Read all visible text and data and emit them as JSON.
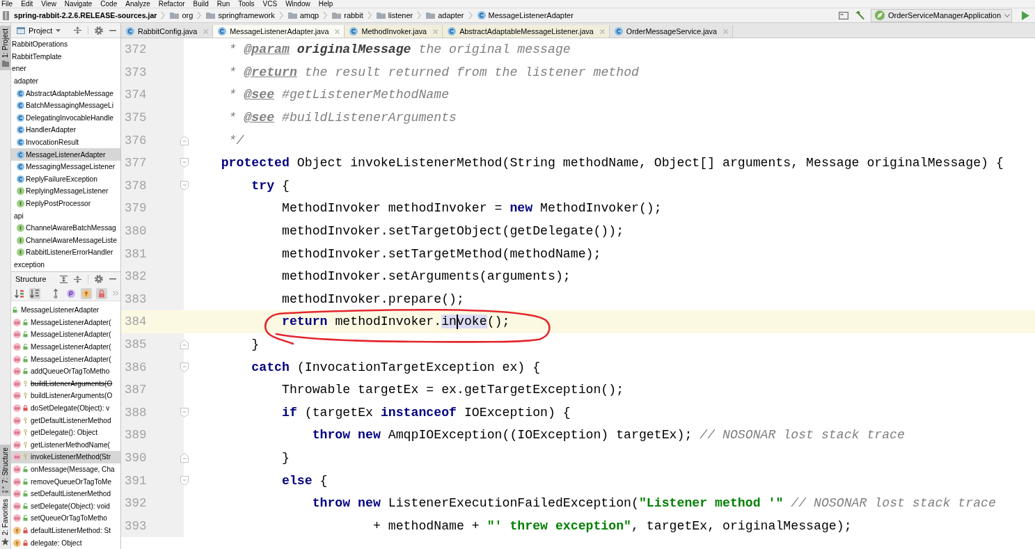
{
  "menu_bar": {
    "items": [
      "File",
      "Edit",
      "View",
      "Navigate",
      "Code",
      "Analyze",
      "Refactor",
      "Build",
      "Run",
      "Tools",
      "VCS",
      "Window",
      "Help"
    ]
  },
  "navigation_bar": {
    "breadcrumbs": [
      {
        "label": "spring-rabbit-2.2.6.RELEASE-sources.jar",
        "kind": "jar"
      },
      {
        "label": "org",
        "kind": "package"
      },
      {
        "label": "springframework",
        "kind": "package"
      },
      {
        "label": "amqp",
        "kind": "package"
      },
      {
        "label": "rabbit",
        "kind": "package"
      },
      {
        "label": "listener",
        "kind": "package"
      },
      {
        "label": "adapter",
        "kind": "package"
      },
      {
        "label": "MessageListenerAdapter",
        "kind": "class"
      }
    ],
    "run_configuration": "OrderServiceManagerApplication"
  },
  "tool_window_bar": [
    {
      "label": "1: Project",
      "kind": "project",
      "selected": true
    },
    {
      "label": "7: Structure",
      "kind": "structure",
      "selected": true
    },
    {
      "label": "2: Favorites",
      "kind": "favorites",
      "selected": false
    }
  ],
  "project_panel": {
    "title": "Project",
    "tree": [
      {
        "label": "RabbitOperations",
        "selected": false
      },
      {
        "label": "RabbitTemplate",
        "selected": false
      },
      {
        "label": "ener",
        "selected": false,
        "children": [
          {
            "label": "adapter",
            "selected": false,
            "children": [
              {
                "label": "AbstractAdaptableMessage",
                "kind": "class",
                "selected": false
              },
              {
                "label": "BatchMessagingMessageLi",
                "kind": "class",
                "selected": false
              },
              {
                "label": "DelegatingInvocableHandle",
                "kind": "class",
                "selected": false
              },
              {
                "label": "HandlerAdapter",
                "kind": "class",
                "selected": false
              },
              {
                "label": "InvocationResult",
                "kind": "class",
                "selected": false
              },
              {
                "label": "MessageListenerAdapter",
                "kind": "class",
                "selected": true
              },
              {
                "label": "MessagingMessageListener",
                "kind": "class",
                "selected": false
              },
              {
                "label": "ReplyFailureException",
                "kind": "class",
                "selected": false
              },
              {
                "label": "ReplyingMessageListener",
                "kind": "interface",
                "selected": false
              },
              {
                "label": "ReplyPostProcessor",
                "kind": "interface",
                "selected": false
              }
            ]
          },
          {
            "label": "api",
            "selected": false,
            "children": [
              {
                "label": "ChannelAwareBatchMessag",
                "kind": "interface",
                "selected": false
              },
              {
                "label": "ChannelAwareMessageListe",
                "kind": "interface",
                "selected": false
              },
              {
                "label": "RabbitListenerErrorHandler",
                "kind": "interface",
                "selected": false
              }
            ]
          },
          {
            "label": "exception",
            "selected": false
          }
        ]
      }
    ]
  },
  "structure_panel": {
    "title": "Structure",
    "toolbar": [
      {
        "kind": "sort-visibility",
        "on": false
      },
      {
        "kind": "sort-alpha",
        "on": true
      },
      {
        "kind": "inherited",
        "on": false
      },
      {
        "kind": "properties",
        "on": false
      },
      {
        "kind": "fields",
        "on": true
      },
      {
        "kind": "non-public",
        "on": true
      }
    ],
    "root": {
      "label": "MessageListenerAdapter",
      "kind": "public-class"
    },
    "members": [
      {
        "label": "MessageListenerAdapter(",
        "kind": "public-method",
        "deprecated": false,
        "selected": false
      },
      {
        "label": "MessageListenerAdapter(",
        "kind": "public-method",
        "deprecated": false,
        "selected": false
      },
      {
        "label": "MessageListenerAdapter(",
        "kind": "public-method",
        "deprecated": false,
        "selected": false
      },
      {
        "label": "MessageListenerAdapter(",
        "kind": "public-method",
        "deprecated": false,
        "selected": false
      },
      {
        "label": "addQueueOrTagToMetho",
        "kind": "public-method",
        "deprecated": false,
        "selected": false
      },
      {
        "label": "buildListenerArguments(O",
        "kind": "protected-method",
        "deprecated": true,
        "selected": false
      },
      {
        "label": "buildListenerArguments(O",
        "kind": "protected-method",
        "deprecated": false,
        "selected": false
      },
      {
        "label": "doSetDelegate(Object): v",
        "kind": "private-method",
        "deprecated": false,
        "selected": false
      },
      {
        "label": "getDefaultListenerMethod",
        "kind": "protected-method",
        "deprecated": false,
        "selected": false
      },
      {
        "label": "getDelegate(): Object",
        "kind": "protected-method",
        "deprecated": false,
        "selected": false
      },
      {
        "label": "getListenerMethodName(",
        "kind": "protected-method",
        "deprecated": false,
        "selected": false
      },
      {
        "label": "invokeListenerMethod(Str",
        "kind": "protected-method",
        "deprecated": false,
        "selected": true
      },
      {
        "label": "onMessage(Message, Cha",
        "kind": "public-method",
        "deprecated": false,
        "selected": false
      },
      {
        "label": "removeQueueOrTagToMe",
        "kind": "public-method",
        "deprecated": false,
        "selected": false
      },
      {
        "label": "setDefaultListenerMethod",
        "kind": "public-method",
        "deprecated": false,
        "selected": false
      },
      {
        "label": "setDelegate(Object): void",
        "kind": "public-method",
        "deprecated": false,
        "selected": false
      },
      {
        "label": "setQueueOrTagToMetho",
        "kind": "public-method",
        "deprecated": false,
        "selected": false
      },
      {
        "label": "defaultListenerMethod: St",
        "kind": "private-field",
        "deprecated": false,
        "selected": false
      },
      {
        "label": "delegate: Object",
        "kind": "private-field",
        "deprecated": false,
        "selected": false
      }
    ]
  },
  "editor_tabs": [
    {
      "label": "RabbitConfig.java",
      "kind": "project",
      "selected": false
    },
    {
      "label": "MessageListenerAdapter.java",
      "kind": "library",
      "selected": true
    },
    {
      "label": "MethodInvoker.java",
      "kind": "library",
      "selected": false
    },
    {
      "label": "AbstractAdaptableMessageListener.java",
      "kind": "library",
      "selected": false
    },
    {
      "label": "OrderMessageService.java",
      "kind": "project",
      "selected": false
    }
  ],
  "editor": {
    "lines": [
      {
        "number": "372",
        "kind": "code",
        "current": false,
        "circled": false,
        "tokens": [
          {
            "text": "     * ",
            "kind": "comment"
          },
          {
            "text": "@param",
            "kind": "doc-tag"
          },
          {
            "text": " originalMessage",
            "kind": "doc-param"
          },
          {
            "text": " the original message",
            "kind": "comment"
          }
        ]
      },
      {
        "number": "373",
        "kind": "code",
        "current": false,
        "circled": false,
        "tokens": [
          {
            "text": "     * ",
            "kind": "comment"
          },
          {
            "text": "@return",
            "kind": "doc-tag"
          },
          {
            "text": " the result returned from the listener method",
            "kind": "comment"
          }
        ]
      },
      {
        "number": "374",
        "kind": "code",
        "current": false,
        "circled": false,
        "tokens": [
          {
            "text": "     * ",
            "kind": "comment"
          },
          {
            "text": "@see",
            "kind": "doc-tag"
          },
          {
            "text": " #getListenerMethodName",
            "kind": "comment"
          }
        ]
      },
      {
        "number": "375",
        "kind": "code",
        "current": false,
        "circled": false,
        "tokens": [
          {
            "text": "     * ",
            "kind": "comment"
          },
          {
            "text": "@see",
            "kind": "doc-tag"
          },
          {
            "text": " #buildListenerArguments",
            "kind": "comment"
          }
        ]
      },
      {
        "number": "376",
        "kind": "fold-end",
        "current": false,
        "circled": false,
        "tokens": [
          {
            "text": "     */",
            "kind": "comment"
          }
        ]
      },
      {
        "number": "377",
        "kind": "fold-start",
        "current": false,
        "circled": false,
        "tokens": [
          {
            "text": "    protected",
            "kind": "keyword"
          },
          {
            "text": " Object invokeListenerMethod(String methodName, Object[] arguments, Message originalMessage) {",
            "kind": "plain"
          }
        ]
      },
      {
        "number": "378",
        "kind": "fold-start",
        "current": false,
        "circled": false,
        "tokens": [
          {
            "text": "        try",
            "kind": "keyword"
          },
          {
            "text": " {",
            "kind": "plain"
          }
        ]
      },
      {
        "number": "379",
        "kind": "code",
        "current": false,
        "circled": false,
        "tokens": [
          {
            "text": "            MethodInvoker methodInvoker = ",
            "kind": "plain"
          },
          {
            "text": "new",
            "kind": "keyword"
          },
          {
            "text": " MethodInvoker();",
            "kind": "plain"
          }
        ]
      },
      {
        "number": "380",
        "kind": "code",
        "current": false,
        "circled": false,
        "tokens": [
          {
            "text": "            methodInvoker.setTargetObject(getDelegate());",
            "kind": "plain"
          }
        ]
      },
      {
        "number": "381",
        "kind": "code",
        "current": false,
        "circled": false,
        "tokens": [
          {
            "text": "            methodInvoker.setTargetMethod(methodName);",
            "kind": "plain"
          }
        ]
      },
      {
        "number": "382",
        "kind": "code",
        "current": false,
        "circled": false,
        "tokens": [
          {
            "text": "            methodInvoker.setArguments(arguments);",
            "kind": "plain"
          }
        ]
      },
      {
        "number": "383",
        "kind": "code",
        "current": false,
        "circled": false,
        "tokens": [
          {
            "text": "            methodInvoker.prepare();",
            "kind": "plain"
          }
        ]
      },
      {
        "number": "384",
        "kind": "code",
        "current": true,
        "circled": true,
        "tokens": [
          {
            "text": "            return",
            "kind": "keyword"
          },
          {
            "text": " methodInvoker.",
            "kind": "plain"
          },
          {
            "text": "in",
            "kind": "usage"
          },
          {
            "text": "voke",
            "kind": "usage",
            "caret": true
          },
          {
            "text": "();",
            "kind": "plain"
          }
        ]
      },
      {
        "number": "385",
        "kind": "fold-end",
        "current": false,
        "circled": false,
        "tokens": [
          {
            "text": "        }",
            "kind": "plain"
          }
        ]
      },
      {
        "number": "386",
        "kind": "fold-start",
        "current": false,
        "circled": false,
        "tokens": [
          {
            "text": "        catch",
            "kind": "keyword"
          },
          {
            "text": " (InvocationTargetException ex) {",
            "kind": "plain"
          }
        ]
      },
      {
        "number": "387",
        "kind": "code",
        "current": false,
        "circled": false,
        "tokens": [
          {
            "text": "            Throwable targetEx = ex.getTargetException();",
            "kind": "plain"
          }
        ]
      },
      {
        "number": "388",
        "kind": "fold-start",
        "current": false,
        "circled": false,
        "tokens": [
          {
            "text": "            if",
            "kind": "keyword"
          },
          {
            "text": " (targetEx ",
            "kind": "plain"
          },
          {
            "text": "instanceof",
            "kind": "keyword"
          },
          {
            "text": " IOException) {",
            "kind": "plain"
          }
        ]
      },
      {
        "number": "389",
        "kind": "code",
        "current": false,
        "circled": false,
        "tokens": [
          {
            "text": "                throw new",
            "kind": "keyword"
          },
          {
            "text": " AmqpIOException((IOException) targetEx); ",
            "kind": "plain"
          },
          {
            "text": "// NOSONAR lost stack trace",
            "kind": "comment"
          }
        ]
      },
      {
        "number": "390",
        "kind": "fold-end",
        "current": false,
        "circled": false,
        "tokens": [
          {
            "text": "            }",
            "kind": "plain"
          }
        ]
      },
      {
        "number": "391",
        "kind": "fold-start",
        "current": false,
        "circled": false,
        "tokens": [
          {
            "text": "            else",
            "kind": "keyword"
          },
          {
            "text": " {",
            "kind": "plain"
          }
        ]
      },
      {
        "number": "392",
        "kind": "code",
        "current": false,
        "circled": false,
        "tokens": [
          {
            "text": "                throw new",
            "kind": "keyword"
          },
          {
            "text": " ListenerExecutionFailedException(",
            "kind": "plain"
          },
          {
            "text": "\"Listener method '\"",
            "kind": "string"
          },
          {
            "text": " // NOSONAR lost stack trace",
            "kind": "comment"
          }
        ]
      },
      {
        "number": "393",
        "kind": "code",
        "current": false,
        "circled": false,
        "tokens": [
          {
            "text": "                        + methodName + ",
            "kind": "plain"
          },
          {
            "text": "\"' threw exception\"",
            "kind": "string"
          },
          {
            "text": ", targetEx, originalMessage);",
            "kind": "plain"
          }
        ]
      }
    ]
  }
}
